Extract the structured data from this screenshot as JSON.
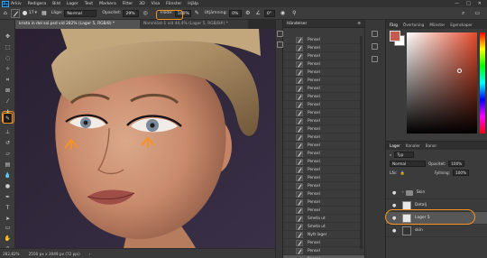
{
  "menu": {
    "logo": "Ps",
    "items": [
      "Arkiv",
      "Redigera",
      "Bild",
      "Lager",
      "Text",
      "Markera",
      "Filter",
      "3D",
      "Visa",
      "Fönster",
      "Hjälp"
    ]
  },
  "options": {
    "size_value": "17",
    "mode_label": "Läge:",
    "mode_value": "Normal",
    "opacity_label": "Opacitet:",
    "opacity_value": "29%",
    "flow_label": "Flöde:",
    "flow_value": "100%",
    "smoothing_label": "Utjämning:",
    "smoothing_value": "0%",
    "angle_value": "0°"
  },
  "tabs": {
    "active": "krista in del sol.psd vid 282% (Lager 5, RGB/8) *",
    "inactive": "Namnlöst-1 vid 44,4% (Lager 5, RGB/8#) *"
  },
  "status": {
    "zoom": "282,82%",
    "dims": "2550 px x 3049 px (72 ppi)"
  },
  "history": {
    "title": "Händelser",
    "items": [
      "Pensel",
      "Pensel",
      "Pensel",
      "Pensel",
      "Pensel",
      "Pensel",
      "Pensel",
      "Pensel",
      "Pensel",
      "Pensel",
      "Pensel",
      "Pensel",
      "Pensel",
      "Pensel",
      "Pensel",
      "Pensel",
      "Pensel",
      "Pensel",
      "Pensel",
      "Pensel",
      "Pensel",
      "Pensel",
      "Smeta ut",
      "Smeta ut",
      "Nytt lager",
      "Pensel",
      "Pensel",
      "Pensel"
    ],
    "active_index": 27
  },
  "color_panel": {
    "tabs": [
      "Färg",
      "Övertoning",
      "Mönster",
      "Egenskaper"
    ],
    "foreground": "#c45b4e",
    "background": "#ffffff"
  },
  "layers_panel": {
    "tabs": [
      "Lager",
      "Kanaler",
      "Banor"
    ],
    "filter_label": "Typ",
    "blend_mode": "Normal",
    "opacity_label": "Opacitet:",
    "opacity_value": "100%",
    "lock_label": "Lås:",
    "fill_label": "Fyllning:",
    "fill_value": "100%",
    "layers": [
      {
        "name": "Skin",
        "kind": "folder"
      },
      {
        "name": "Detalj",
        "kind": "layer"
      },
      {
        "name": "Lager 5",
        "kind": "layer",
        "selected": true
      },
      {
        "name": "skin",
        "kind": "layer"
      }
    ]
  },
  "colors": {
    "highlight": "#f7931e"
  }
}
